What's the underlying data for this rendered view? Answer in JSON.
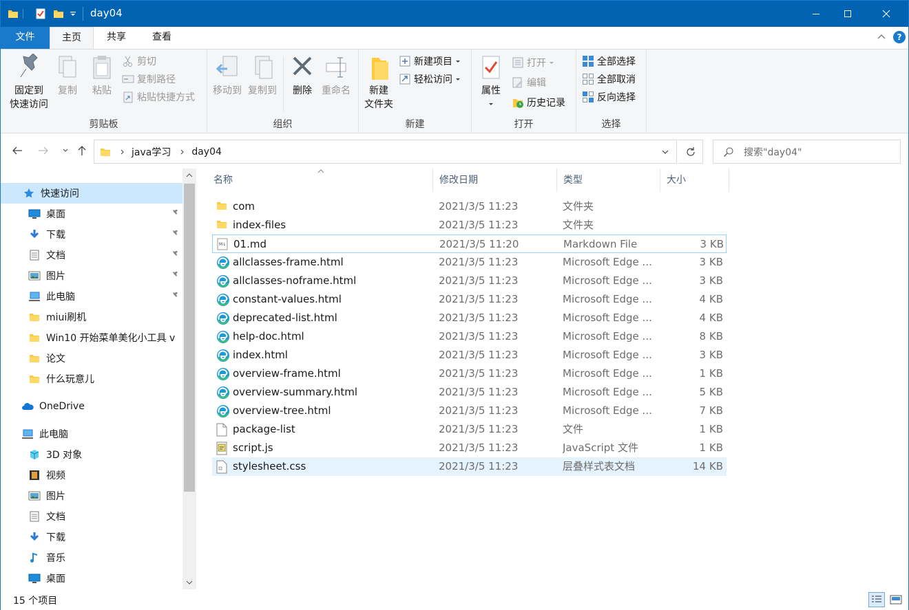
{
  "window": {
    "title": "day04",
    "quick_access_toolbar": [
      "folder-icon",
      "properties-icon",
      "new-folder-icon",
      "customize-icon"
    ]
  },
  "ribbon_tabs": {
    "file": "文件",
    "home": "主页",
    "share": "共享",
    "view": "查看"
  },
  "ribbon": {
    "clipboard": {
      "label": "剪贴板",
      "pin_l1": "固定到",
      "pin_l2": "快速访问",
      "copy": "复制",
      "paste": "粘贴",
      "cut": "剪切",
      "copy_path": "复制路径",
      "paste_shortcut": "粘贴快捷方式"
    },
    "organize": {
      "label": "组织",
      "move_to": "移动到",
      "copy_to": "复制到",
      "delete": "删除",
      "rename": "重命名"
    },
    "new": {
      "label": "新建",
      "new_folder_l1": "新建",
      "new_folder_l2": "文件夹",
      "new_item": "新建项目",
      "easy_access": "轻松访问"
    },
    "open": {
      "label": "打开",
      "properties": "属性",
      "open": "打开",
      "edit": "编辑",
      "history": "历史记录"
    },
    "select": {
      "label": "选择",
      "select_all": "全部选择",
      "select_none": "全部取消",
      "invert": "反向选择"
    }
  },
  "address": {
    "crumbs": [
      "java学习",
      "day04"
    ],
    "search_placeholder": "搜索\"day04\""
  },
  "nav_pane": {
    "quick_access": "快速访问",
    "quick_items": [
      {
        "label": "桌面",
        "icon": "desktop-icon",
        "pinned": true
      },
      {
        "label": "下载",
        "icon": "download-icon",
        "pinned": true
      },
      {
        "label": "文档",
        "icon": "document-icon",
        "pinned": true
      },
      {
        "label": "图片",
        "icon": "picture-icon",
        "pinned": true
      },
      {
        "label": "此电脑",
        "icon": "computer-icon",
        "pinned": true
      },
      {
        "label": "miui刷机",
        "icon": "folder-icon",
        "pinned": false
      },
      {
        "label": "Win10 开始菜单美化小工具 v",
        "icon": "folder-icon",
        "pinned": false
      },
      {
        "label": "论文",
        "icon": "folder-icon",
        "pinned": false
      },
      {
        "label": "什么玩意儿",
        "icon": "folder-icon",
        "pinned": false
      }
    ],
    "onedrive": "OneDrive",
    "this_pc": "此电脑",
    "pc_items": [
      {
        "label": "3D 对象",
        "icon": "3d-objects-icon"
      },
      {
        "label": "视频",
        "icon": "video-icon"
      },
      {
        "label": "图片",
        "icon": "picture-icon"
      },
      {
        "label": "文档",
        "icon": "document-icon"
      },
      {
        "label": "下载",
        "icon": "download-icon"
      },
      {
        "label": "音乐",
        "icon": "music-icon"
      },
      {
        "label": "桌面",
        "icon": "desktop-icon"
      }
    ]
  },
  "file_list": {
    "columns": {
      "name": "名称",
      "date": "修改日期",
      "type": "类型",
      "size": "大小"
    },
    "rows": [
      {
        "name": "com",
        "date": "2021/3/5 11:23",
        "type": "文件夹",
        "size": "",
        "icon": "folder-icon"
      },
      {
        "name": "index-files",
        "date": "2021/3/5 11:23",
        "type": "文件夹",
        "size": "",
        "icon": "folder-icon"
      },
      {
        "name": "01.md",
        "date": "2021/3/5 11:20",
        "type": "Markdown File",
        "size": "3 KB",
        "icon": "markdown-file-icon"
      },
      {
        "name": "allclasses-frame.html",
        "date": "2021/3/5 11:23",
        "type": "Microsoft Edge ...",
        "size": "3 KB",
        "icon": "edge-icon"
      },
      {
        "name": "allclasses-noframe.html",
        "date": "2021/3/5 11:23",
        "type": "Microsoft Edge ...",
        "size": "3 KB",
        "icon": "edge-icon"
      },
      {
        "name": "constant-values.html",
        "date": "2021/3/5 11:23",
        "type": "Microsoft Edge ...",
        "size": "4 KB",
        "icon": "edge-icon"
      },
      {
        "name": "deprecated-list.html",
        "date": "2021/3/5 11:23",
        "type": "Microsoft Edge ...",
        "size": "4 KB",
        "icon": "edge-icon"
      },
      {
        "name": "help-doc.html",
        "date": "2021/3/5 11:23",
        "type": "Microsoft Edge ...",
        "size": "8 KB",
        "icon": "edge-icon"
      },
      {
        "name": "index.html",
        "date": "2021/3/5 11:23",
        "type": "Microsoft Edge ...",
        "size": "3 KB",
        "icon": "edge-icon"
      },
      {
        "name": "overview-frame.html",
        "date": "2021/3/5 11:23",
        "type": "Microsoft Edge ...",
        "size": "1 KB",
        "icon": "edge-icon"
      },
      {
        "name": "overview-summary.html",
        "date": "2021/3/5 11:23",
        "type": "Microsoft Edge ...",
        "size": "5 KB",
        "icon": "edge-icon"
      },
      {
        "name": "overview-tree.html",
        "date": "2021/3/5 11:23",
        "type": "Microsoft Edge ...",
        "size": "7 KB",
        "icon": "edge-icon"
      },
      {
        "name": "package-list",
        "date": "2021/3/5 11:23",
        "type": "文件",
        "size": "1 KB",
        "icon": "blank-file-icon"
      },
      {
        "name": "script.js",
        "date": "2021/3/5 11:23",
        "type": "JavaScript 文件",
        "size": "1 KB",
        "icon": "script-file-icon"
      },
      {
        "name": "stylesheet.css",
        "date": "2021/3/5 11:23",
        "type": "层叠样式表文档",
        "size": "14 KB",
        "icon": "css-file-icon"
      }
    ]
  },
  "status": {
    "item_count": "15 个项目"
  },
  "colors": {
    "titlebar": "#0063b1",
    "file_tab": "#1979ca",
    "selection": "#cce8ff",
    "hover_row": "#e5f3ff",
    "folder": "#ffc83d"
  }
}
